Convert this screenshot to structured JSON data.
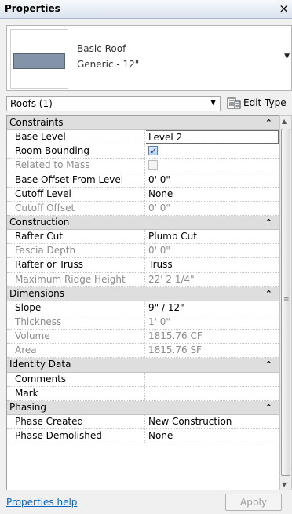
{
  "window": {
    "title": "Properties",
    "close_glyph": "×"
  },
  "type_selector": {
    "family": "Basic Roof",
    "type": "Generic - 12\"",
    "dropdown_glyph": "▼"
  },
  "filter": {
    "value": "Roofs (1)",
    "arrow": "▼"
  },
  "edit_type": {
    "label": "Edit Type",
    "icon": "edit-type-icon"
  },
  "groups": [
    {
      "name": "Constraints",
      "collapse_glyph": "⌃",
      "rows": [
        {
          "label": "Base Level",
          "value": "Level 2",
          "kind": "edit",
          "dim": false
        },
        {
          "label": "Room Bounding",
          "value": "",
          "kind": "check-on",
          "dim": false
        },
        {
          "label": "Related to Mass",
          "value": "",
          "kind": "check-off",
          "dim": true
        },
        {
          "label": "Base Offset From Level",
          "value": "0'  0\"",
          "kind": "text",
          "dim": false
        },
        {
          "label": "Cutoff Level",
          "value": "None",
          "kind": "text",
          "dim": false
        },
        {
          "label": "Cutoff Offset",
          "value": "0'  0\"",
          "kind": "text",
          "dim": true
        }
      ]
    },
    {
      "name": "Construction",
      "collapse_glyph": "⌃",
      "rows": [
        {
          "label": "Rafter Cut",
          "value": "Plumb Cut",
          "kind": "text",
          "dim": false
        },
        {
          "label": "Fascia Depth",
          "value": "0'  0\"",
          "kind": "text",
          "dim": true
        },
        {
          "label": "Rafter or Truss",
          "value": "Truss",
          "kind": "text",
          "dim": false
        },
        {
          "label": "Maximum Ridge Height",
          "value": "22'  2 1/4\"",
          "kind": "text",
          "dim": true
        }
      ]
    },
    {
      "name": "Dimensions",
      "collapse_glyph": "⌃",
      "rows": [
        {
          "label": "Slope",
          "value": "9\" / 12\"",
          "kind": "text",
          "dim": false
        },
        {
          "label": "Thickness",
          "value": "1'  0\"",
          "kind": "text",
          "dim": true
        },
        {
          "label": "Volume",
          "value": "1815.76 CF",
          "kind": "text",
          "dim": true
        },
        {
          "label": "Area",
          "value": "1815.76 SF",
          "kind": "text",
          "dim": true
        }
      ]
    },
    {
      "name": "Identity Data",
      "collapse_glyph": "⌃",
      "rows": [
        {
          "label": "Comments",
          "value": "",
          "kind": "text",
          "dim": false
        },
        {
          "label": "Mark",
          "value": "",
          "kind": "text",
          "dim": false
        }
      ]
    },
    {
      "name": "Phasing",
      "collapse_glyph": "⌃",
      "rows": [
        {
          "label": "Phase Created",
          "value": "New Construction",
          "kind": "text",
          "dim": false
        },
        {
          "label": "Phase Demolished",
          "value": "None",
          "kind": "text",
          "dim": false
        }
      ]
    }
  ],
  "footer": {
    "help_link": "Properties help",
    "apply_label": "Apply"
  },
  "scrollbar": {
    "up": "▲",
    "down": "▼",
    "grip": "≡"
  },
  "colors": {
    "group_header_bg": "#dedede",
    "dim_text": "#8c8c8c",
    "link": "#0563c1"
  }
}
